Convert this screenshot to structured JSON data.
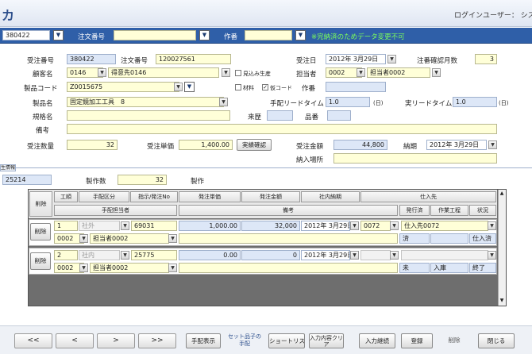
{
  "header": {
    "title": "カ",
    "login_label": "ログインユーザー： シス"
  },
  "topbar": {
    "order_no_value": "380422",
    "chuumon_label": "注文番号",
    "chuumon_value": "",
    "sagyou_label": "作番",
    "sagyou_value": "",
    "warning": "※完納済のためデータ変更不可"
  },
  "form": {
    "juchu_no_label": "受注番号",
    "juchu_no": "380422",
    "chuumon_label": "注文番号",
    "chuumon": "120027561",
    "juchu_date_label": "受注日",
    "juchu_date": "2012年 3月29日",
    "kakunin_label": "注番確認月数",
    "kakunin": "3",
    "kokyaku_label": "顧客名",
    "kokyaku_code": "0146",
    "kokyaku_name": "得意先0146",
    "mikomi_label": "見込み生産",
    "tantou_label": "担当者",
    "tantou_code": "0002",
    "tantou_name": "担当者0002",
    "seihin_code_label": "製品コード",
    "seihin_code": "Z0015675",
    "zairyou_label": "材料",
    "kari_label": "仮コード",
    "kari_checked": "✓",
    "sakuban_label": "作番",
    "sakuban": "",
    "seihin_name_label": "製品名",
    "seihin_name": "固定鏡加工工具　8",
    "tehai_lt_label": "手配リードタイム",
    "tehai_lt": "1.0",
    "unit_day": "(日)",
    "jitsu_lt_label": "実リードタイム",
    "jitsu_lt": "1.0",
    "unit_day2": "(日)",
    "kikaku_label": "規格名",
    "kikaku": "",
    "raireki_label": "来歴",
    "raireki": "",
    "hinban_label": "品番",
    "hinban": "",
    "bikou_label": "備考",
    "bikou": "",
    "suuryou_label": "受注数量",
    "suuryou": "32",
    "tanka_label": "受注単価",
    "tanka": "1,400.00",
    "jisseki_btn": "実績確認",
    "kingaku_label": "受注金額",
    "kingaku": "44,800",
    "nouki_label": "納期",
    "nouki": "2012年 3月29日",
    "nounyu_label": "納入場所",
    "nounyu": ""
  },
  "section": {
    "tab_label": "生情報",
    "left_value": "25214",
    "seisaku_label": "製作数",
    "seisaku": "32",
    "seisaku2_label": "製作"
  },
  "grid": {
    "delete_label": "削除",
    "headers_row1": [
      "工順",
      "手配区分",
      "指示/発注No",
      "発注単価",
      "発注金額",
      "社内納期",
      "仕入先"
    ],
    "headers_row2_left": "手配担当者",
    "headers_row2_mid": "備考",
    "headers_row2_right": [
      "発行済",
      "作業工程",
      "状況"
    ],
    "rows": [
      {
        "delete": "削除",
        "seq": "1",
        "kubun": "社外",
        "no": "69031",
        "tanka": "1,000.00",
        "kingaku": "32,000",
        "date": "2012年 3月29日",
        "vcode": "0072",
        "vname": "仕入先0072",
        "tcode": "0002",
        "tname": "担当者0002",
        "bikou": "",
        "issued": "済",
        "process": "",
        "status": "仕入済"
      },
      {
        "delete": "削除",
        "seq": "2",
        "kubun": "社内",
        "no": "25775",
        "tanka": "0.00",
        "kingaku": "0",
        "date": "2012年 3月29日",
        "vcode": "",
        "vname": "",
        "tcode": "0002",
        "tname": "担当者0002",
        "bikou": "",
        "issued": "未",
        "process": "入庫",
        "status": "終了"
      }
    ]
  },
  "footer": {
    "first": "<<",
    "prev": "<",
    "next": ">",
    "last": ">>",
    "tehai": "手配表示",
    "set": "セット品子の手配",
    "shortlist": "ショートリスト",
    "clear": "入力内容クリア",
    "keizoku": "入力継続",
    "touroku": "登録",
    "sakujo": "削除",
    "close": "閉じる"
  },
  "colors": {
    "bar": "#2f5fa8",
    "input_yellow": "#ffffd8",
    "input_blue": "#dde7f7",
    "warning": "#7cff5a"
  }
}
